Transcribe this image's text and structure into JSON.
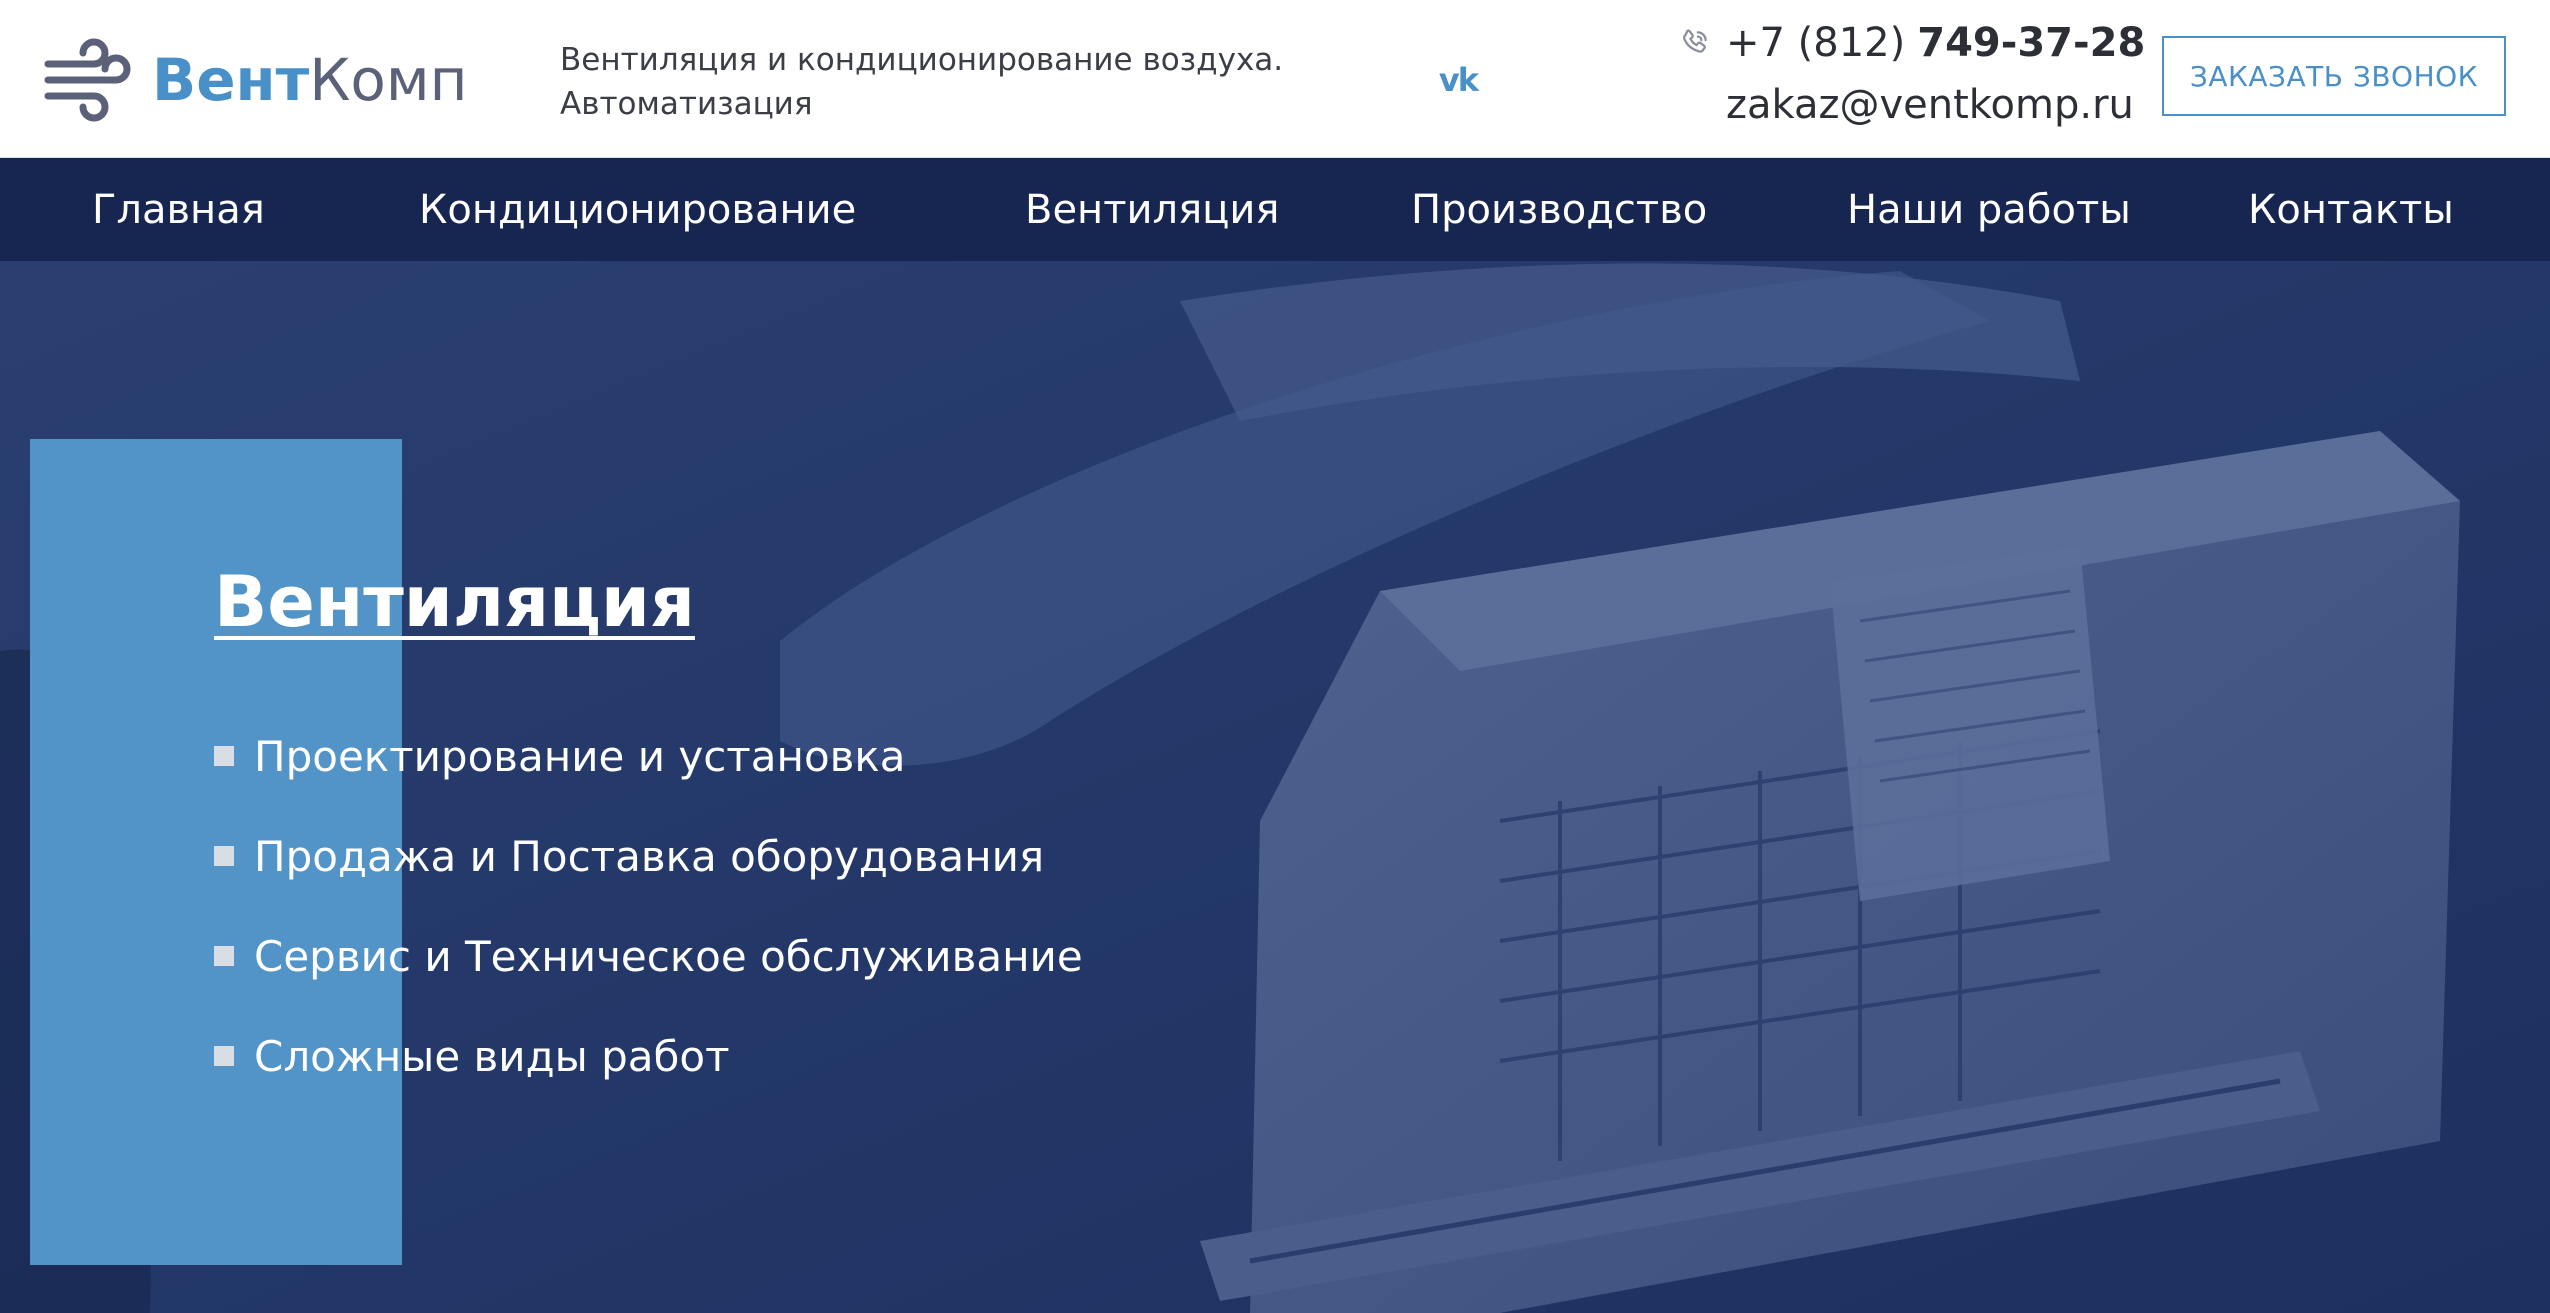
{
  "header": {
    "logo": {
      "text_part1": "Вент",
      "text_part2": "Комп",
      "icon": "wind-icon",
      "brand_color": "#4a90c8",
      "secondary_color": "#5a6178"
    },
    "tagline": {
      "line1": "Вентиляция и кондиционирование воздуха.",
      "line2": "Автоматизация"
    },
    "social": {
      "vk_label": "vk",
      "icon": "vk-icon"
    },
    "contacts": {
      "phone_icon": "phone-icon",
      "phone_prefix": "+7 (812)",
      "phone_number": "749-37-28",
      "email": "zakaz@ventkomp.ru"
    },
    "callback_button": "ЗАКАЗАТЬ ЗВОНОК"
  },
  "nav": {
    "background": "#172650",
    "items": [
      {
        "label": "Главная"
      },
      {
        "label": "Кондиционирование"
      },
      {
        "label": "Вентиляция"
      },
      {
        "label": "Производство"
      },
      {
        "label": "Наши работы"
      },
      {
        "label": "Контакты"
      }
    ]
  },
  "hero": {
    "overlay_color": "#1f3566",
    "accent_color": "#5294c8",
    "title": "Вентиляция",
    "items": [
      {
        "label": "Проектирование и установка"
      },
      {
        "label": "Продажа и Поставка оборудования"
      },
      {
        "label": "Сервис и Техническое обслуживание"
      },
      {
        "label": "Сложные виды работ"
      }
    ]
  }
}
